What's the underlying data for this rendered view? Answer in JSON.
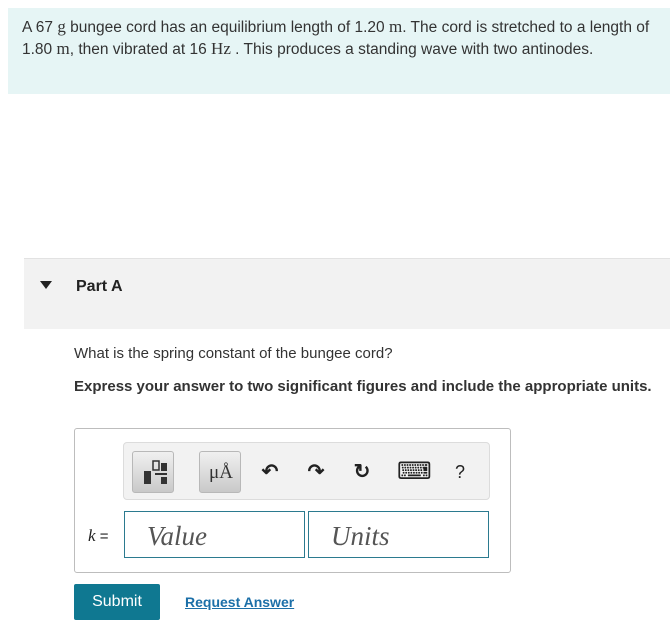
{
  "problem": {
    "t1": "A 67 ",
    "m1": "g",
    "t2": " bungee cord has an equilibrium length of 1.20 ",
    "m2": "m",
    "t3": ". The cord is stretched to a length of 1.80 ",
    "m3": "m",
    "t4": ", then vibrated at 16 ",
    "m4": "Hz",
    "t5": " . This produces a standing wave with two antinodes."
  },
  "part": {
    "title": "Part A"
  },
  "question": "What is the spring constant of the bungee cord?",
  "instructions": "Express your answer to two significant figures and include the appropriate units.",
  "answer": {
    "variable": "k",
    "equals": " =",
    "value_placeholder": "Value",
    "units_placeholder": "Units"
  },
  "toolbar": {
    "units_button_label": "μÅ",
    "undo_glyph": "↶",
    "redo_glyph": "↷",
    "reset_glyph": "↻",
    "keyboard_glyph": "⌨",
    "help_glyph": "?",
    "icons": [
      "templates-icon",
      "units-icon",
      "undo-icon",
      "redo-icon",
      "reset-icon",
      "keyboard-icon",
      "help-icon"
    ]
  },
  "buttons": {
    "submit": "Submit",
    "request_answer": "Request Answer"
  },
  "colors": {
    "problem_bg": "#e6f5f5",
    "accent": "#0f7891",
    "link": "#1b6fa8",
    "input_border": "#2b7a8f"
  }
}
